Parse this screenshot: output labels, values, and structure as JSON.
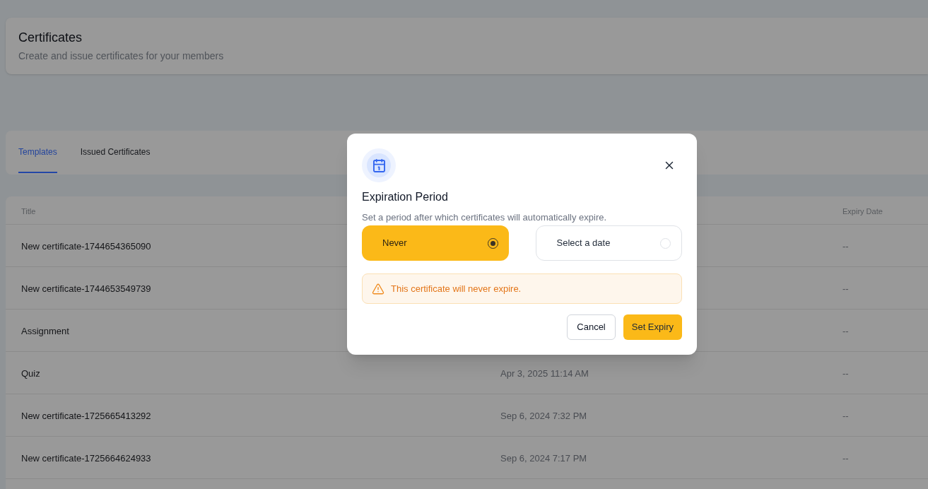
{
  "header": {
    "title": "Certificates",
    "subtitle": "Create and issue certificates for your members"
  },
  "tabs": [
    {
      "label": "Templates",
      "selected": true
    },
    {
      "label": "Issued Certificates",
      "selected": false
    }
  ],
  "table": {
    "columns": {
      "title": "Title",
      "expiry_date": "Expiry Date"
    },
    "rows": [
      {
        "title": "New certificate-1744654365090",
        "expiry_date": "--"
      },
      {
        "title": "New certificate-1744653549739",
        "expiry_date": "--"
      },
      {
        "title": "Assignment",
        "expiry_date": "--"
      },
      {
        "title": "Quiz",
        "column_2": "Apr 3, 2025 11:14 AM",
        "expiry_date": "--"
      },
      {
        "title": "New certificate-1725665413292",
        "column_2": "Sep 6, 2024 7:32 PM",
        "expiry_date": "--"
      },
      {
        "title": "New certificate-1725664624933",
        "column_2": "Sep 6, 2024 7:17 PM",
        "expiry_date": "--"
      }
    ]
  },
  "dialog": {
    "title": "Expiration Period",
    "description": "Set a period after which certificates will automatically expire.",
    "options": [
      {
        "label": "Never",
        "selected": true
      },
      {
        "label": "Select a date",
        "selected": false
      }
    ],
    "alert": {
      "text": "This certificate will never expire."
    },
    "buttons": [
      {
        "label": "Cancel",
        "kind": "secondary"
      },
      {
        "label": "Set Expiry",
        "kind": "primary"
      }
    ]
  }
}
